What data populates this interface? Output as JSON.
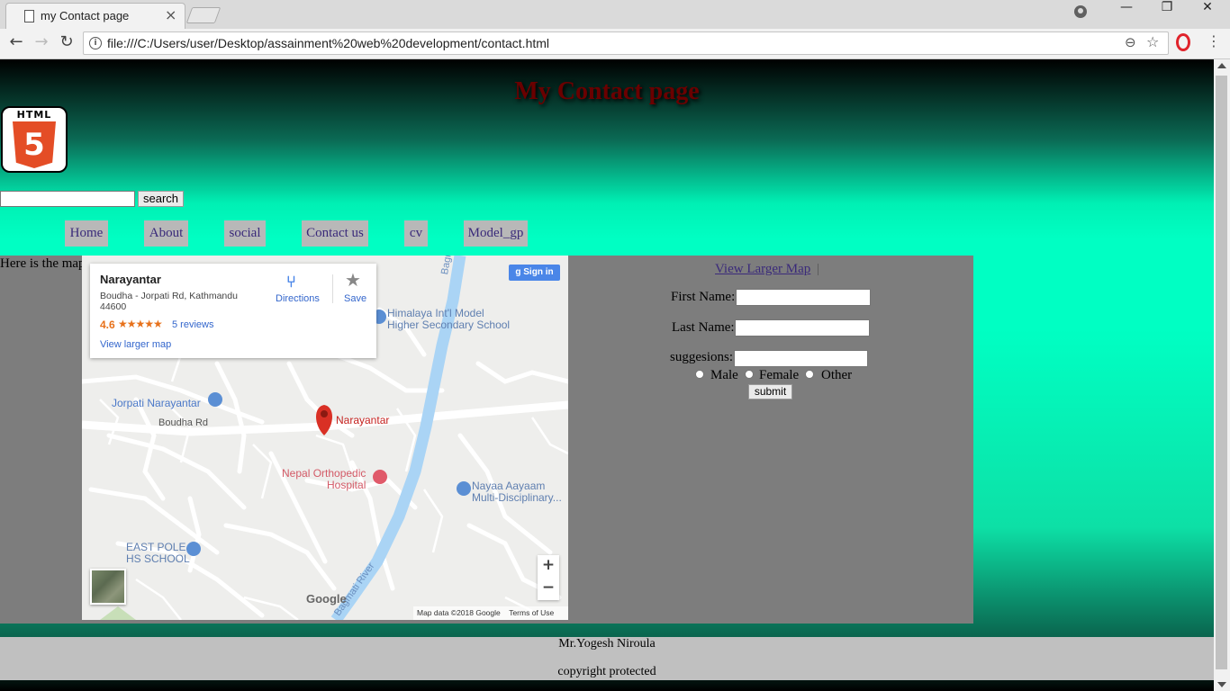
{
  "browser": {
    "tab_title": "my Contact page",
    "url": "file:///C:/Users/user/Desktop/assainment%20web%20development/contact.html"
  },
  "page": {
    "heading": "My Contact page",
    "logo_text": "HTML",
    "logo_digit": "5",
    "search_button": "search",
    "nav": [
      "Home",
      "About",
      "social",
      "Contact us",
      "cv",
      "Model_gp"
    ]
  },
  "map_section": {
    "caption": "Here is the map",
    "place_name": "Narayantar",
    "address": "Boudha - Jorpati Rd, Kathmandu 44600",
    "rating": "4.6",
    "stars": "★★★★★",
    "reviews": "5 reviews",
    "view_larger_card": "View larger map",
    "directions": "Directions",
    "save": "Save",
    "sign_in": "Sign in",
    "labels": {
      "school1_a": "Himalaya Int'l Model",
      "school1_b": "Higher Secondary School",
      "jorpati": "Jorpati Narayantar",
      "boudha_rd": "Boudha Rd",
      "pin": "Narayantar",
      "hospital_a": "Nepal Orthopedic",
      "hospital_b": "Hospital",
      "nayaa_a": "Nayaa Aayaam",
      "nayaa_b": "Multi-Disciplinary...",
      "eastpole_a": "EAST POLE",
      "eastpole_b": "HS SCHOOL",
      "bagmati_top": "Bagmati",
      "bagmati_river": "Bagmati River"
    },
    "zoom_in": "+",
    "zoom_out": "−",
    "google": "Google",
    "map_data": "Map data ©2018 Google",
    "terms": "Terms of Use"
  },
  "form": {
    "view_larger": "View Larger Map",
    "separator": "|",
    "first_name": "First Name:",
    "last_name": "Last Name:",
    "suggestions": "suggesions:",
    "gender_options": [
      "Male",
      "Female",
      "Other"
    ],
    "submit": "submit"
  },
  "footer": {
    "author": "Mr.Yogesh Niroula",
    "copyright": "copyright protected"
  },
  "colors": {
    "nav_bg": "#b8b8b8",
    "content_bg": "#7d7d7d",
    "footer_bg": "#c0c0c0",
    "heading": "#6a0000",
    "gradient_mid": "#00ffc3"
  }
}
